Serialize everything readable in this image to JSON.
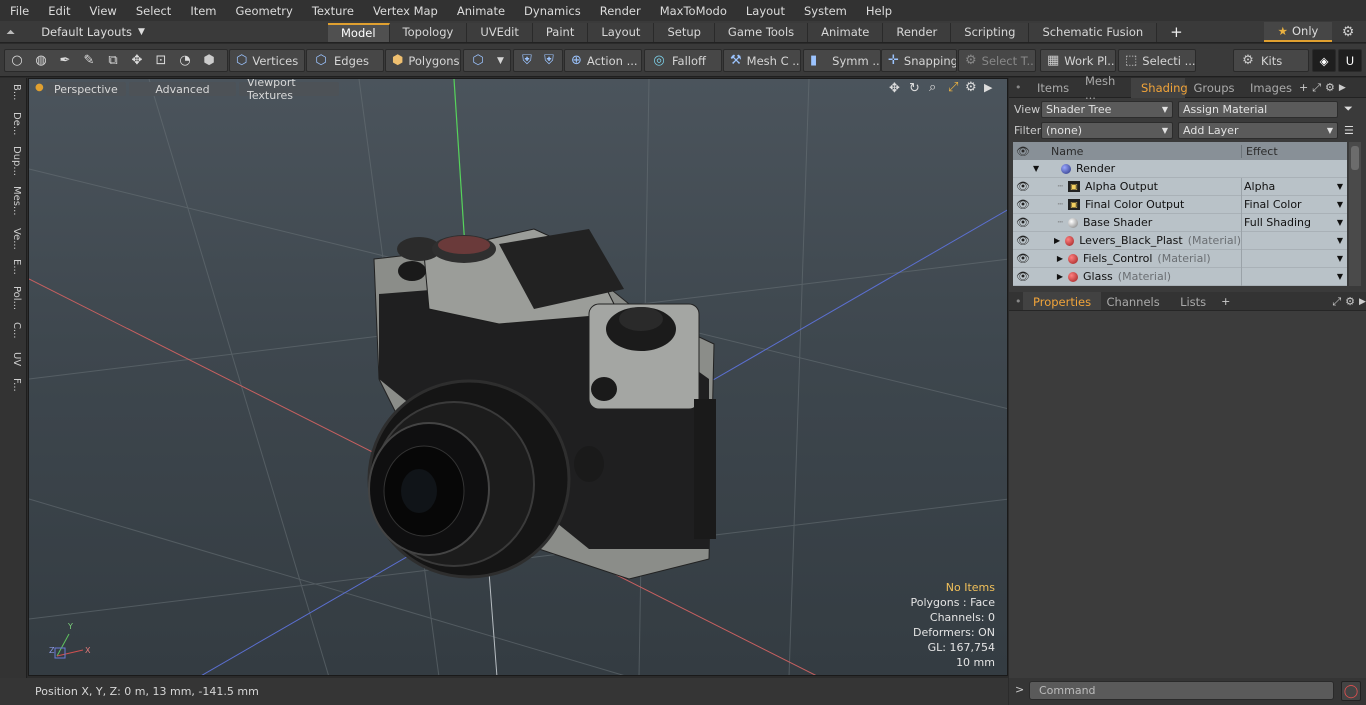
{
  "menu": [
    "File",
    "Edit",
    "View",
    "Select",
    "Item",
    "Geometry",
    "Texture",
    "Vertex Map",
    "Animate",
    "Dynamics",
    "Render",
    "MaxToModo",
    "Layout",
    "System",
    "Help"
  ],
  "layout": {
    "label": "Default Layouts",
    "only_label": "Only"
  },
  "tabs": [
    "Model",
    "Topology",
    "UVEdit",
    "Paint",
    "Layout",
    "Setup",
    "Game Tools",
    "Animate",
    "Render",
    "Scripting",
    "Schematic Fusion"
  ],
  "toolbar": {
    "vertices": "Vertices",
    "edges": "Edges",
    "polygons": "Polygons",
    "action": "Action ...",
    "falloff": "Falloff",
    "mesh": "Mesh C ...",
    "symm": "Symm ...",
    "snapping": "Snapping",
    "select_t": "Select T...",
    "workpl": "Work Pl...",
    "selecti": "Selecti ...",
    "kits": "Kits"
  },
  "left_tabs": [
    "B...",
    "De...",
    "Dup...",
    "Mes...",
    "Ve...",
    "E...",
    "Pol...",
    "C...",
    "UV",
    "F..."
  ],
  "viewport": {
    "perspective": "Perspective",
    "advanced": "Advanced",
    "textures": "Viewport Textures",
    "info": {
      "items": "No Items",
      "polygons": "Polygons : Face",
      "channels": "Channels: 0",
      "deformers": "Deformers: ON",
      "gl": "GL: 167,754",
      "scale": "10 mm"
    },
    "axis": {
      "x": "X",
      "y": "Y",
      "z": "Z"
    }
  },
  "status": {
    "position": "Position X, Y, Z:   0 m, 13 mm, -141.5 mm"
  },
  "panel": {
    "tabs": [
      "Items",
      "Mesh ...",
      "Shading",
      "Groups",
      "Images"
    ],
    "view_label": "View",
    "view_value": "Shader Tree",
    "assign": "Assign Material",
    "filter_label": "Filter",
    "filter_value": "(none)",
    "add_layer": "Add Layer",
    "col_name": "Name",
    "col_effect": "Effect",
    "rows": [
      {
        "name": "Render",
        "mat": "",
        "effect": ""
      },
      {
        "name": "Alpha Output",
        "mat": "",
        "effect": "Alpha"
      },
      {
        "name": "Final Color Output",
        "mat": "",
        "effect": "Final Color"
      },
      {
        "name": "Base Shader",
        "mat": "",
        "effect": "Full Shading"
      },
      {
        "name": "Levers_Black_Plast",
        "mat": "(Material)",
        "effect": ""
      },
      {
        "name": "Fiels_Control",
        "mat": "(Material)",
        "effect": ""
      },
      {
        "name": "Glass",
        "mat": "(Material)",
        "effect": ""
      }
    ],
    "props_tabs": [
      "Properties",
      "Channels",
      "Lists"
    ],
    "command_placeholder": "Command"
  }
}
